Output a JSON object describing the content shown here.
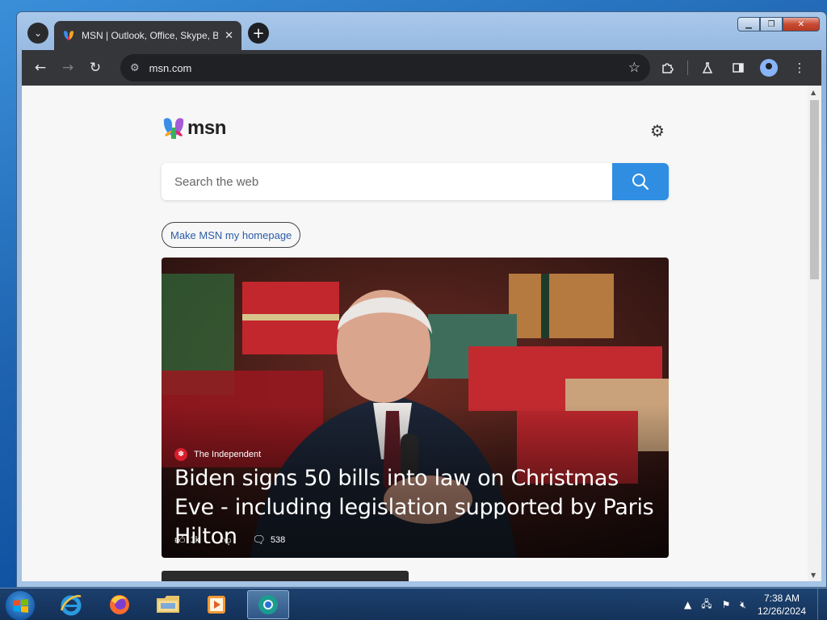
{
  "browser": {
    "tab_title": "MSN | Outlook, Office, Skype, Bing, Breaking News",
    "tab_close_glyph": "✕",
    "new_tab_glyph": "+",
    "url": "msn.com"
  },
  "page": {
    "brand": "msn",
    "search_placeholder": "Search the web",
    "homepage_button": "Make MSN my homepage",
    "hero": {
      "source": "The Independent",
      "headline": "Biden signs 50 bills into law on Christmas Eve - including legislation supported by Paris Hilton",
      "likes": "1k",
      "comments": "538"
    }
  },
  "taskbar": {
    "time": "7:38 AM",
    "date": "12/26/2024"
  },
  "icons": {
    "tab_search": "chevron-down-icon",
    "back": "arrow-left-icon",
    "forward": "arrow-right-icon",
    "reload": "reload-icon",
    "site_info": "tune-icon",
    "bookmark": "star-icon",
    "extensions": "puzzle-icon",
    "labs": "flask-icon",
    "side_panel": "side-panel-icon",
    "profile": "profile-icon",
    "menu": "kebab-menu-icon",
    "settings": "gear-icon",
    "search": "search-icon"
  },
  "colors": {
    "msn_search_button": "#2f8ee2",
    "chrome_toolbar": "#35363a",
    "homepage_link": "#2b5ca9"
  }
}
